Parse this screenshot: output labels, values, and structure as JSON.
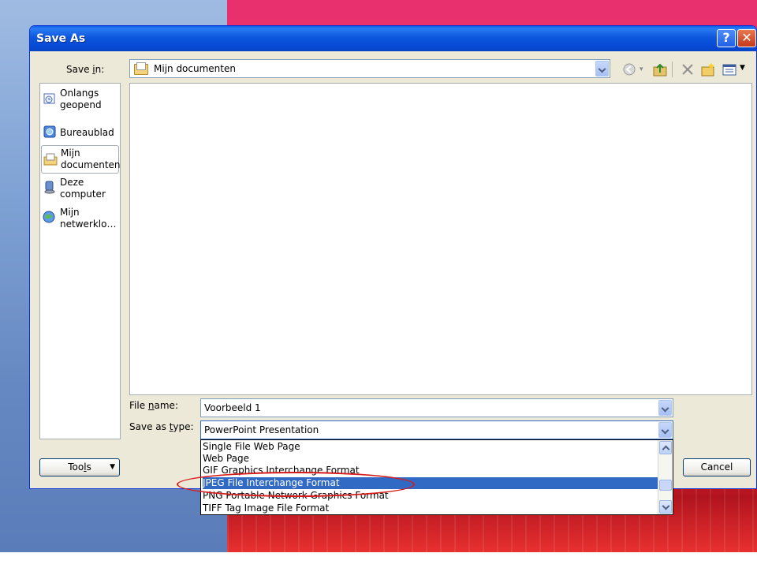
{
  "dialog": {
    "title": "Save As",
    "help_glyph": "?",
    "close_glyph": "✕"
  },
  "save_in": {
    "label_pre": "Save ",
    "label_key": "i",
    "label_post": "n:",
    "value": "Mijn documenten"
  },
  "places": [
    {
      "label": "Onlangs geopend",
      "icon": "recent-documents-icon"
    },
    {
      "label": "Bureaublad",
      "icon": "desktop-icon"
    },
    {
      "label": "Mijn documenten",
      "icon": "my-documents-icon"
    },
    {
      "label": "Deze computer",
      "icon": "my-computer-icon"
    },
    {
      "label": "Mijn netwerklo…",
      "icon": "network-places-icon"
    }
  ],
  "file_name": {
    "label_pre": "File ",
    "label_key": "n",
    "label_post": "ame:",
    "value": "Voorbeeld 1"
  },
  "save_type": {
    "label_pre": "Save as ",
    "label_key": "t",
    "label_post": "ype:",
    "value": "PowerPoint Presentation",
    "options": [
      "Single File Web Page",
      "Web Page",
      "GIF Graphics Interchange Format",
      "JPEG File Interchange Format",
      "PNG Portable Network Graphics Format",
      "TIFF Tag Image File Format"
    ],
    "highlighted": "JPEG File Interchange Format"
  },
  "buttons": {
    "tools_pre": "Too",
    "tools_key": "l",
    "tools_post": "s",
    "cancel": "Cancel"
  },
  "colors": {
    "title_bar": "#0d57de",
    "selection": "#316ac5",
    "annotation": "#d81b1b"
  }
}
